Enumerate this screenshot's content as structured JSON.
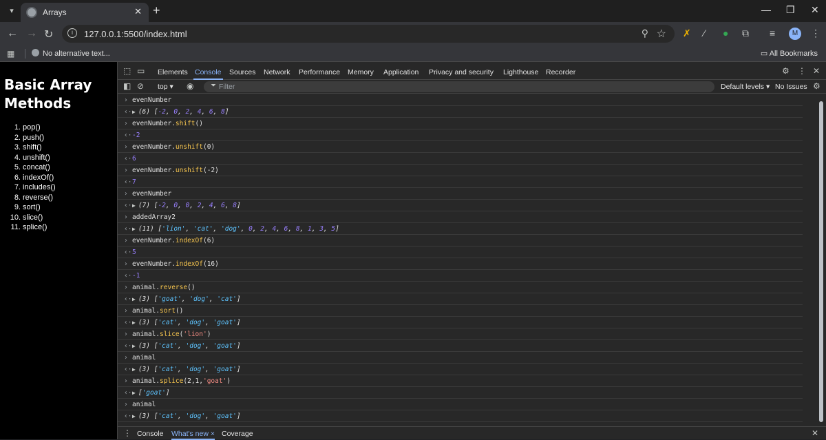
{
  "browser": {
    "tab_title": "Arrays",
    "url": "127.0.0.1:5500/index.html",
    "avatar_letter": "M",
    "bookmark_item": "No alternative text...",
    "all_bookmarks": "All Bookmarks"
  },
  "page": {
    "heading": "Basic Array Methods",
    "methods": [
      {
        "num": "1.",
        "name": "pop()"
      },
      {
        "num": "2.",
        "name": "push()"
      },
      {
        "num": "3.",
        "name": "shift()"
      },
      {
        "num": "4.",
        "name": "unshift()"
      },
      {
        "num": "5.",
        "name": "concat()"
      },
      {
        "num": "6.",
        "name": "indexOf()"
      },
      {
        "num": "7.",
        "name": "includes()"
      },
      {
        "num": "8.",
        "name": "reverse()"
      },
      {
        "num": "9.",
        "name": "sort()"
      },
      {
        "num": "10.",
        "name": "slice()"
      },
      {
        "num": "11.",
        "name": "splice()"
      }
    ]
  },
  "devtools": {
    "tabs": [
      "Elements",
      "Console",
      "Sources",
      "Network",
      "Performance",
      "Memory",
      "Application",
      "Privacy and security",
      "Lighthouse",
      "Recorder"
    ],
    "active_tab": "Console",
    "context": "top ▾",
    "filter_placeholder": "Filter",
    "levels": "Default levels ▾",
    "issues": "No Issues",
    "drawer_tabs": [
      "Console",
      "What's new ×",
      "Coverage"
    ]
  },
  "console": [
    {
      "kind": "in",
      "html": "evenNumber"
    },
    {
      "kind": "arr",
      "html": "(6) [<span class='num'>-2</span>, <span class='num'>0</span>, <span class='num'>2</span>, <span class='num'>4</span>, <span class='num'>6</span>, <span class='num'>8</span>]"
    },
    {
      "kind": "in",
      "html": "evenNumber.<span class='m'>shift</span>()"
    },
    {
      "kind": "out",
      "html": "-2"
    },
    {
      "kind": "in",
      "html": "evenNumber.<span class='m'>unshift</span>(0)"
    },
    {
      "kind": "out",
      "html": "6"
    },
    {
      "kind": "in",
      "html": "evenNumber.<span class='m'>unshift</span>(-2)"
    },
    {
      "kind": "out",
      "html": "7"
    },
    {
      "kind": "in",
      "html": "evenNumber"
    },
    {
      "kind": "arr",
      "html": "(7) [<span class='num'>-2</span>, <span class='num'>0</span>, <span class='num'>0</span>, <span class='num'>2</span>, <span class='num'>4</span>, <span class='num'>6</span>, <span class='num'>8</span>]"
    },
    {
      "kind": "in",
      "html": "addedArray2"
    },
    {
      "kind": "arr",
      "html": "(11) [<span class='q'>'lion'</span>, <span class='q'>'cat'</span>, <span class='q'>'dog'</span>, <span class='num'>0</span>, <span class='num'>2</span>, <span class='num'>4</span>, <span class='num'>6</span>, <span class='num'>8</span>, <span class='num'>1</span>, <span class='num'>3</span>, <span class='num'>5</span>]"
    },
    {
      "kind": "in",
      "html": "evenNumber.<span class='m'>indexOf</span>(6)"
    },
    {
      "kind": "out",
      "html": "5"
    },
    {
      "kind": "in",
      "html": "evenNumber.<span class='m'>indexOf</span>(16)"
    },
    {
      "kind": "out",
      "html": "-1"
    },
    {
      "kind": "in",
      "html": "animal.<span class='m'>reverse</span>()"
    },
    {
      "kind": "arr",
      "html": "(3) [<span class='q'>'goat'</span>, <span class='q'>'dog'</span>, <span class='q'>'cat'</span>]"
    },
    {
      "kind": "in",
      "html": "animal.<span class='m'>sort</span>()"
    },
    {
      "kind": "arr",
      "html": "(3) [<span class='q'>'cat'</span>, <span class='q'>'dog'</span>, <span class='q'>'goat'</span>]"
    },
    {
      "kind": "in",
      "html": "animal.<span class='m'>slice</span>(<span class='s'>'lion'</span>)"
    },
    {
      "kind": "arr",
      "html": "(3) [<span class='q'>'cat'</span>, <span class='q'>'dog'</span>, <span class='q'>'goat'</span>]"
    },
    {
      "kind": "in",
      "html": "animal"
    },
    {
      "kind": "arr",
      "html": "(3) [<span class='q'>'cat'</span>, <span class='q'>'dog'</span>, <span class='q'>'goat'</span>]"
    },
    {
      "kind": "in",
      "html": "animal.<span class='m'>splice</span>(2,1,<span class='s'>'goat'</span>)"
    },
    {
      "kind": "arr",
      "html": "[<span class='q'>'goat'</span>]"
    },
    {
      "kind": "in",
      "html": "animal"
    },
    {
      "kind": "arr",
      "html": "(3) [<span class='q'>'cat'</span>, <span class='q'>'dog'</span>, <span class='q'>'goat'</span>]"
    }
  ],
  "colors": {
    "accent": "#8ab4f8",
    "method": "#f9c74f",
    "string": "#f28b82",
    "number": "#9980ff",
    "quoted": "#5ec4ff"
  }
}
